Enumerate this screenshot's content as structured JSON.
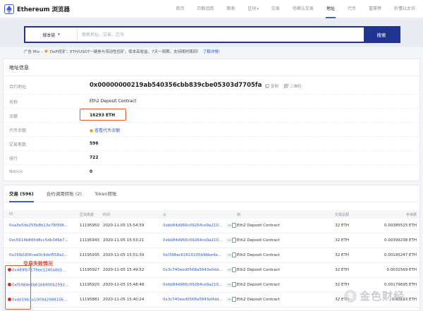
{
  "brand": {
    "name": "Ethereum 浏览器"
  },
  "nav": [
    {
      "label": "首页",
      "caret": false,
      "active": false
    },
    {
      "label": "巨鲸追踪",
      "caret": false,
      "active": false
    },
    {
      "label": "图表",
      "caret": false,
      "active": false
    },
    {
      "label": "区块",
      "caret": true,
      "active": false
    },
    {
      "label": "交易",
      "caret": false,
      "active": false
    },
    {
      "label": "待确认交易",
      "caret": false,
      "active": false
    },
    {
      "label": "地址",
      "caret": false,
      "active": true
    },
    {
      "label": "代币",
      "caret": false,
      "active": false
    },
    {
      "label": "富豪榜",
      "caret": false,
      "active": false
    },
    {
      "label": "秒懂以太坊",
      "caret": false,
      "active": false
    }
  ],
  "search": {
    "chain_label": "搜本链",
    "placeholder": "搜索地址、交易、区块",
    "button_label": "搜索"
  },
  "ad": {
    "prefix": "广告 Mix -",
    "highlight": "DeFi挖矿",
    "text": "：ETH/USDT一键参与流动性挖矿，保本高收益，7天一周期，支持随时赎回！",
    "link": "了解详情!"
  },
  "address_info": {
    "title": "地址信息",
    "address_label": "合约地址",
    "address": "0x00000000219ab540356cbb839cbe05303d7705fa",
    "copy_label": "复制",
    "qr_label": "二维码",
    "name_label": "名称",
    "name": "Eth2 Deposit Contract",
    "balance_label": "余额",
    "balance": "16293 ETH",
    "token_balance_label": "代币余额",
    "token_balance_link": "查看代币余额",
    "tx_count_label": "交易笔数",
    "tx_count": "596",
    "rank_label": "排行",
    "rank": "722",
    "nonce_label": "Nonce",
    "nonce": "0"
  },
  "tx_tabs": [
    {
      "label": "交易 (596)",
      "active": true
    },
    {
      "label": "合约调用转账 (2)",
      "active": false
    },
    {
      "label": "Token转账",
      "active": false
    }
  ],
  "tx_table": {
    "columns": [
      "ID",
      "区块高度",
      "时间",
      "从",
      "到",
      "交易总额",
      "手续费"
    ],
    "rows": [
      {
        "failed": false,
        "hash": "0xa3e5de255b8b13e78f996...",
        "block": "11195950",
        "time": "2020-11-05 15:54:59",
        "from": "0xbb84d966c09264ce9a210...",
        "to": "Eth2 Deposit Contract",
        "value": "32 ETH",
        "fee": "0.00385515 ETH"
      },
      {
        "failed": false,
        "hash": "0xc5614b845d8cc5db346b7...",
        "block": "11195943",
        "time": "2020-11-05 15:53:21",
        "from": "0xbb84d966c09264ce9a210...",
        "to": "Eth2 Deposit Contract",
        "value": "32 ETH",
        "fee": "0.00399238 ETH"
      },
      {
        "failed": false,
        "hash": "0x25fb183fcad0c9def558a2...",
        "block": "11195935",
        "time": "2020-11-05 15:51:39",
        "from": "0xf398ac61610105b9bbe4a...",
        "to": "Eth2 Deposit Contract",
        "value": "32 ETH",
        "fee": "0.00195247 ETH"
      },
      {
        "failed": true,
        "hash": "0x489fb7178ee1240a0b5...",
        "block": "11195927",
        "time": "2020-11-05 15:49:52",
        "from": "0x3c740eed0568a5643e0dd...",
        "to": "Eth2 Deposit Contract",
        "value": "32 ETH",
        "fee": "0.0031569 ETH"
      },
      {
        "failed": true,
        "hash": "0xf5984e6b616b900b2592...",
        "block": "11195920",
        "time": "2020-11-05 15:48:48",
        "from": "0xbb84d966c09264ce9a210...",
        "to": "Eth2 Deposit Contract",
        "value": "32 ETH",
        "fee": "0.00179695 ETH"
      },
      {
        "failed": true,
        "hash": "0xde19b3a1009d2988156...",
        "block": "11195881",
        "time": "2020-11-05 15:40:24",
        "from": "0x3c740eed0568a5643e0dd...",
        "to": "Eth2 Deposit Contract",
        "value": "32 ETH",
        "fee": "0.00193 ETH"
      }
    ]
  },
  "annotation": {
    "failed_note": "交易失败情况"
  },
  "watermark": {
    "text": "金色财经"
  },
  "colors": {
    "accent": "#1f3393",
    "link": "#2d5bd8",
    "failed": "#d9262c",
    "highlight_box": "#e25a2c"
  }
}
